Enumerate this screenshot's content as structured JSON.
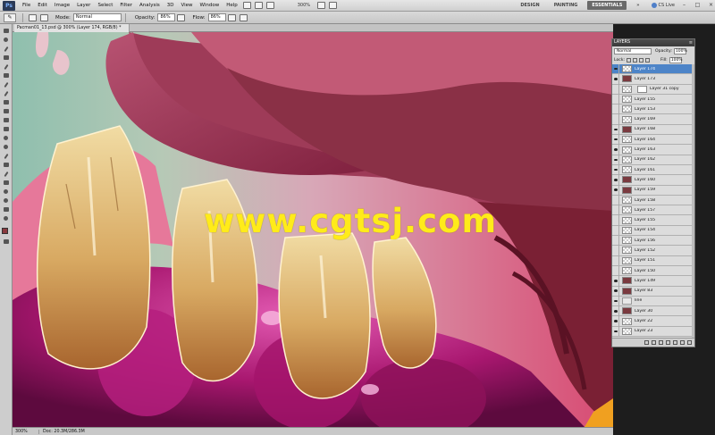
{
  "app": {
    "logo": "Ps"
  },
  "menubar": {
    "items": [
      "File",
      "Edit",
      "Image",
      "Layer",
      "Select",
      "Filter",
      "Analysis",
      "3D",
      "View",
      "Window",
      "Help"
    ],
    "zoom": "300%",
    "workspaces": [
      "DESIGN",
      "PAINTING",
      "ESSENTIALS"
    ],
    "active_workspace": "ESSENTIALS",
    "cs_live": "CS Live"
  },
  "optionsbar": {
    "mode_label": "Mode:",
    "mode_value": "Normal",
    "opacity_label": "Opacity:",
    "opacity_value": "86%",
    "flow_label": "Flow:",
    "flow_value": "86%"
  },
  "document": {
    "tab_title": "Pacman01_13.psd @ 300% (Layer 174, RGB/8) *",
    "watermark": "www.cgtsj.com"
  },
  "statusbar": {
    "zoom": "300%",
    "doc_size": "Doc: 20.3M/286.3M"
  },
  "layers_panel": {
    "title": "LAYERS",
    "blend_mode": "Normal",
    "opacity_label": "Opacity:",
    "opacity_value": "100%",
    "lock_label": "Lock:",
    "fill_label": "Fill:",
    "fill_value": "100%",
    "layers": [
      {
        "name": "Layer 174",
        "visible": true,
        "selected": true,
        "thumb": "check"
      },
      {
        "name": "Layer 173",
        "visible": true,
        "selected": false,
        "thumb": "art"
      },
      {
        "name": "Layer 31 copy",
        "visible": false,
        "selected": false,
        "thumb": "mask"
      },
      {
        "name": "Layer 155",
        "visible": false,
        "selected": false,
        "thumb": "check"
      },
      {
        "name": "Layer 153",
        "visible": false,
        "selected": false,
        "thumb": "check"
      },
      {
        "name": "Layer 169",
        "visible": false,
        "selected": false,
        "thumb": "check"
      },
      {
        "name": "Layer 168",
        "visible": true,
        "selected": false,
        "thumb": "art"
      },
      {
        "name": "Layer 164",
        "visible": true,
        "selected": false,
        "thumb": "check"
      },
      {
        "name": "Layer 163",
        "visible": true,
        "selected": false,
        "thumb": "check"
      },
      {
        "name": "Layer 162",
        "visible": true,
        "selected": false,
        "thumb": "check"
      },
      {
        "name": "Layer 161",
        "visible": true,
        "selected": false,
        "thumb": "check"
      },
      {
        "name": "Layer 160",
        "visible": true,
        "selected": false,
        "thumb": "art"
      },
      {
        "name": "Layer 159",
        "visible": true,
        "selected": false,
        "thumb": "art"
      },
      {
        "name": "Layer 158",
        "visible": false,
        "selected": false,
        "thumb": "check"
      },
      {
        "name": "Layer 157",
        "visible": false,
        "selected": false,
        "thumb": "check"
      },
      {
        "name": "Layer 155",
        "visible": false,
        "selected": false,
        "thumb": "check"
      },
      {
        "name": "Layer 154",
        "visible": false,
        "selected": false,
        "thumb": "check"
      },
      {
        "name": "Layer 156",
        "visible": false,
        "selected": false,
        "thumb": "check"
      },
      {
        "name": "Layer 152",
        "visible": false,
        "selected": false,
        "thumb": "check"
      },
      {
        "name": "Layer 151",
        "visible": false,
        "selected": false,
        "thumb": "check"
      },
      {
        "name": "Layer 150",
        "visible": false,
        "selected": false,
        "thumb": "check"
      },
      {
        "name": "Layer 149",
        "visible": true,
        "selected": false,
        "thumb": "art"
      },
      {
        "name": "Layer 83",
        "visible": true,
        "selected": false,
        "thumb": "art"
      },
      {
        "name": "line",
        "visible": true,
        "selected": false,
        "thumb": "folder"
      },
      {
        "name": "Layer 30",
        "visible": true,
        "selected": false,
        "thumb": "art"
      },
      {
        "name": "Layer 22",
        "visible": true,
        "selected": false,
        "thumb": "check"
      },
      {
        "name": "Layer 23",
        "visible": true,
        "selected": false,
        "thumb": "check"
      }
    ]
  }
}
